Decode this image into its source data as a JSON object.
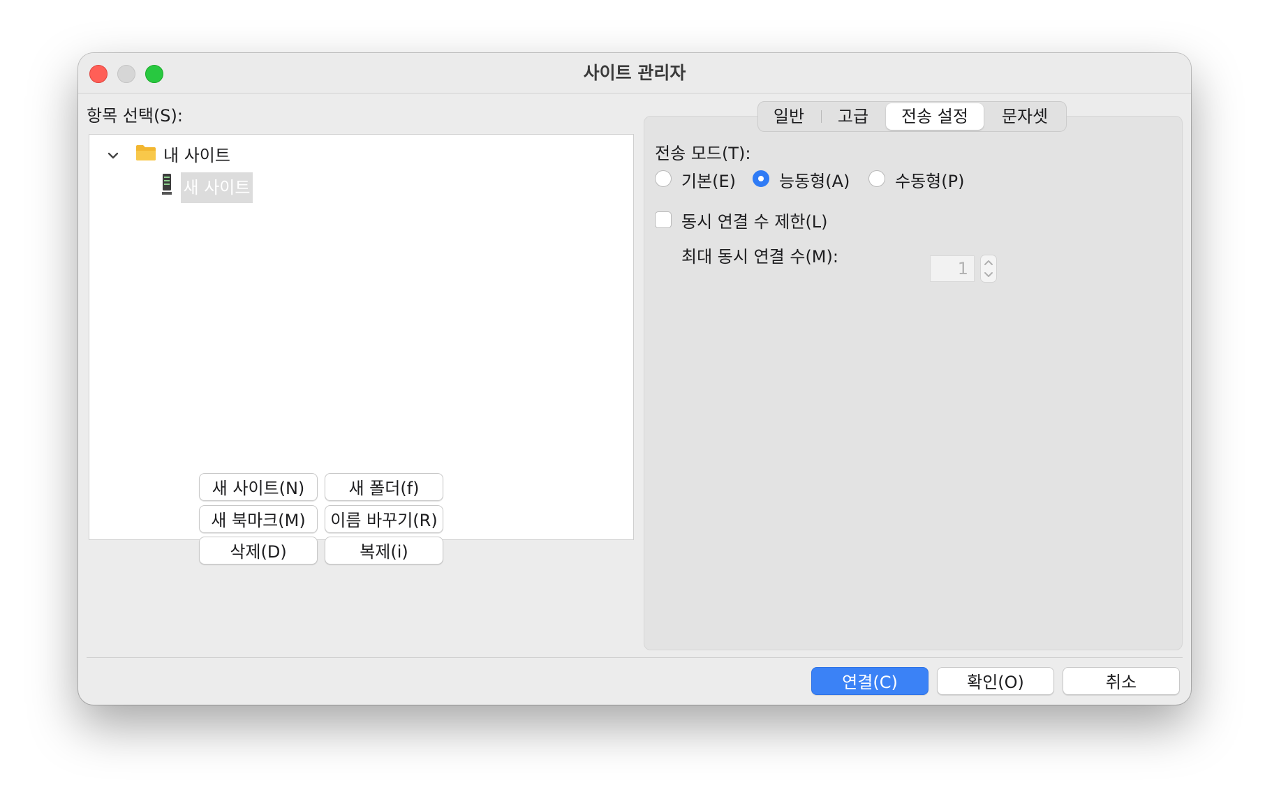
{
  "window": {
    "title": "사이트 관리자"
  },
  "left": {
    "select_label": "항목 선택(S):",
    "tree": {
      "folder_label": "내 사이트",
      "site_label": "새 사이트"
    },
    "buttons": {
      "new_site": "새 사이트(N)",
      "new_folder": "새 폴더(f)",
      "new_bookmark": "새 북마크(M)",
      "rename": "이름 바꾸기(R)",
      "delete": "삭제(D)",
      "duplicate": "복제(i)"
    }
  },
  "tabs": [
    {
      "label": "일반"
    },
    {
      "label": "고급"
    },
    {
      "label": "전송 설정"
    },
    {
      "label": "문자셋"
    }
  ],
  "transfer": {
    "mode_label": "전송 모드(T):",
    "modes": [
      {
        "label": "기본(E)",
        "checked": false
      },
      {
        "label": "능동형(A)",
        "checked": true
      },
      {
        "label": "수동형(P)",
        "checked": false
      }
    ],
    "limit_label": "동시 연결 수 제한(L)",
    "limit_checked": false,
    "max_label": "최대 동시 연결 수(M):",
    "max_value": "1"
  },
  "footer": {
    "connect": "연결(C)",
    "ok": "확인(O)",
    "cancel": "취소"
  },
  "colors": {
    "accent": "#3b82f6",
    "close": "#ff5f57",
    "maximize": "#28c840"
  }
}
